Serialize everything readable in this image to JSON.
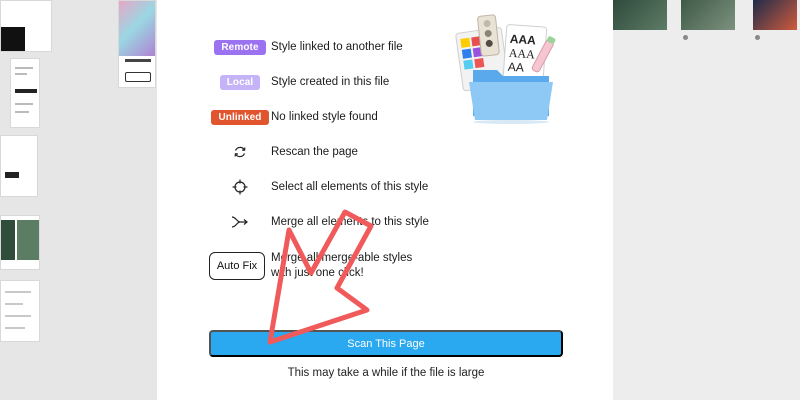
{
  "legend": {
    "remote": {
      "badge": "Remote",
      "color": "#9b73f0",
      "text": "Style linked to another file"
    },
    "local": {
      "badge": "Local",
      "color": "#c4b3f6",
      "text": "Style created in this file"
    },
    "unlinked": {
      "badge": "Unlinked",
      "color": "#e1552e",
      "text": "No linked style found"
    }
  },
  "actions": {
    "rescan": {
      "icon": "refresh-icon",
      "text": "Rescan the page"
    },
    "select": {
      "icon": "crosshair-icon",
      "text": "Select all elements of this style"
    },
    "merge": {
      "icon": "merge-arrow-icon",
      "text": "Merge all elements to this style"
    }
  },
  "autofix": {
    "button_label": "Auto Fix",
    "text_line1": "Merge all merge-able styles",
    "text_line2": "with just one click!"
  },
  "scan": {
    "button_label": "Scan This Page",
    "note": "This may take a while if the file is large",
    "color": "#2aa8f0"
  },
  "annotation": {
    "icon": "red-arrow-icon",
    "color": "#f05a5a"
  }
}
